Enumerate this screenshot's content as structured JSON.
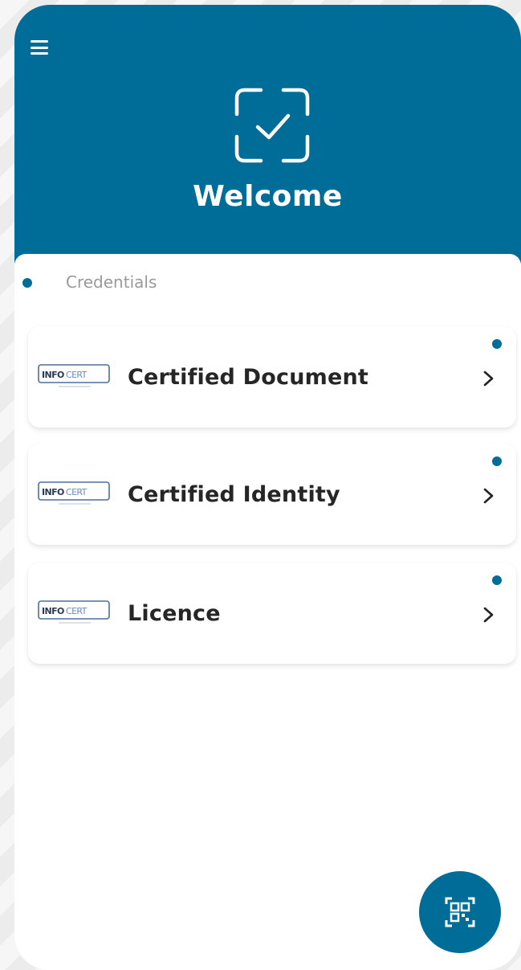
{
  "header": {
    "menu_icon": "hamburger-menu-icon",
    "hero_icon": "checkbox-check-icon",
    "title": "Welcome"
  },
  "credentials": {
    "section_label": "Credentials",
    "items": [
      {
        "title": "Certified Document",
        "logo_text": "INFOCERT",
        "logo_sub": "TINEXTA GROUP",
        "has_new_indicator": true,
        "chevron_icon": "chevron-right-icon"
      },
      {
        "title": "Certified Identity",
        "logo_text": "INFOCERT",
        "logo_sub": "TINEXTA GROUP",
        "has_new_indicator": true,
        "chevron_icon": "chevron-right-icon"
      },
      {
        "title": "Licence",
        "logo_text": "INFOCERT",
        "logo_sub": "TINEXTA GROUP",
        "has_new_indicator": true,
        "chevron_icon": "chevron-right-icon"
      }
    ]
  },
  "fab": {
    "icon": "qr-scan-icon"
  },
  "colors": {
    "primary": "#006d98",
    "header_text": "#ffffff",
    "card_title": "#262626",
    "section_label": "#9a9a9a"
  }
}
